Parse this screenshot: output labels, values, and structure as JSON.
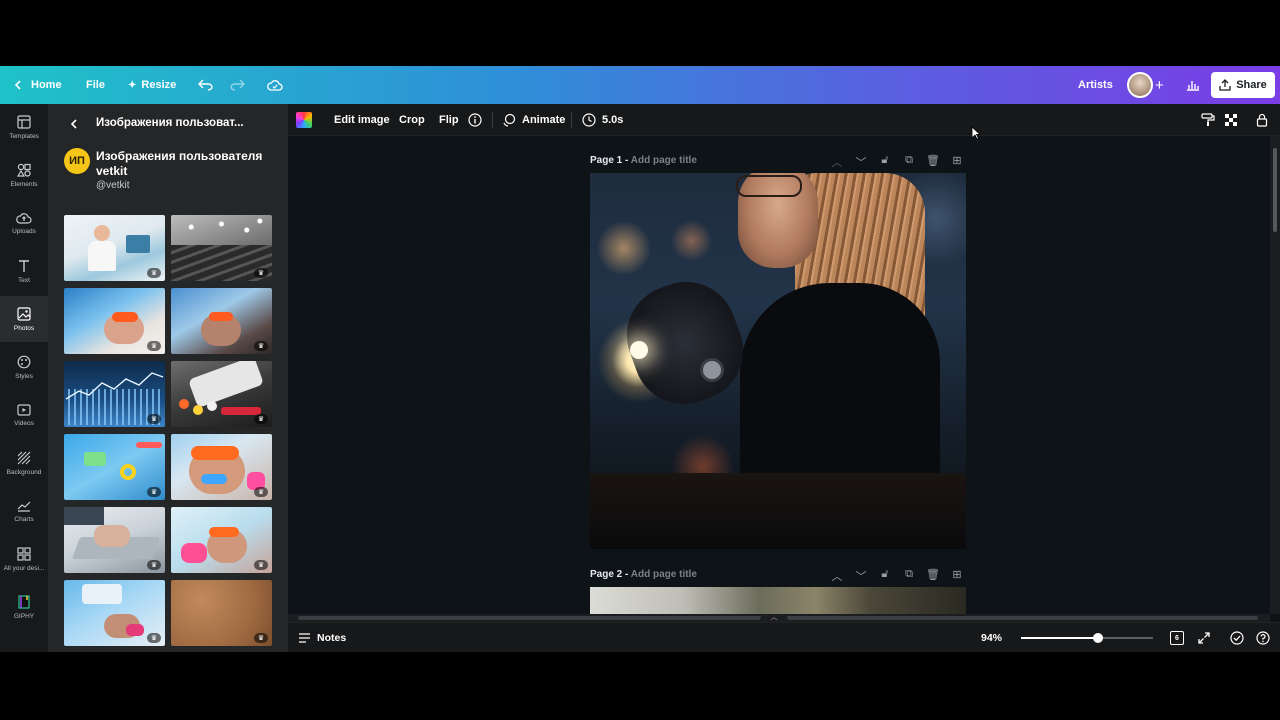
{
  "topbar": {
    "home_label": "Home",
    "file_label": "File",
    "resize_label": "Resize",
    "team_label": "Artists",
    "share_label": "Share",
    "colors": {
      "gradient_start": "#1fc2c8",
      "gradient_end": "#7a3de6"
    }
  },
  "rail": {
    "items": [
      {
        "label": "Templates",
        "icon": "templates-icon"
      },
      {
        "label": "Elements",
        "icon": "elements-icon"
      },
      {
        "label": "Uploads",
        "icon": "uploads-icon"
      },
      {
        "label": "Text",
        "icon": "text-icon"
      },
      {
        "label": "Photos",
        "icon": "photos-icon"
      },
      {
        "label": "Styles",
        "icon": "styles-icon"
      },
      {
        "label": "Videos",
        "icon": "videos-icon"
      },
      {
        "label": "Background",
        "icon": "background-icon"
      },
      {
        "label": "Charts",
        "icon": "charts-icon"
      },
      {
        "label": "All your desi...",
        "icon": "designs-icon"
      },
      {
        "label": "GIPHY",
        "icon": "giphy-icon"
      }
    ]
  },
  "panel": {
    "title": "Изображения пользоват...",
    "profile_initials": "ИП",
    "profile_name": "Изображения пользователя vetkit",
    "profile_handle": "@vetkit"
  },
  "imagebar": {
    "edit_label": "Edit image",
    "crop_label": "Crop",
    "flip_label": "Flip",
    "animate_label": "Animate",
    "duration_label": "5.0s"
  },
  "canvas": {
    "page1_label": "Page 1 -",
    "page1_title_placeholder": "Add page title",
    "page2_label": "Page 2 -",
    "page2_title_placeholder": "Add page title"
  },
  "bottombar": {
    "notes_label": "Notes",
    "zoom_label": "94%",
    "zoom_slider_fraction": 0.58,
    "page_count": "6"
  }
}
